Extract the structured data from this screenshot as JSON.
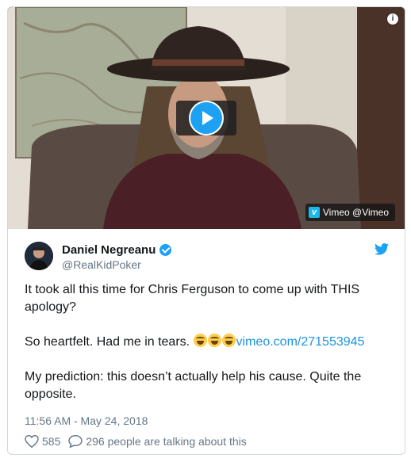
{
  "media": {
    "info_icon": "info-icon",
    "play_icon": "play-icon",
    "badge": {
      "logo_letter": "v",
      "label": "Vimeo @Vimeo"
    }
  },
  "author": {
    "name": "Daniel Negreanu",
    "handle": "@RealKidPoker",
    "verified_icon": "verified-badge-icon",
    "avatar_icon": "avatar"
  },
  "tweet": {
    "line1": "It took all this time for Chris Ferguson to come up with THIS apology?",
    "line2_text": "So heartfelt. Had me in tears. ",
    "emoji_count": 3,
    "link": "vimeo.com/271553945",
    "line3": "My prediction: this doesn’t actually help his cause. Quite the opposite.",
    "timestamp": "11:56 AM - May 24, 2018"
  },
  "actions": {
    "likes": "585",
    "talking": "296 people are talking about this"
  },
  "colors": {
    "accent": "#1da1f2",
    "link": "#1b95e0",
    "muted": "#657786",
    "text": "#14171a"
  }
}
